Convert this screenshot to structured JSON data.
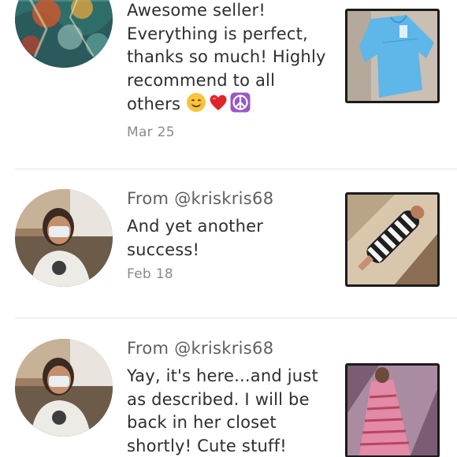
{
  "reviews": [
    {
      "author": "",
      "text": "Awesome seller!\nEverything is perfect,\nthanks so much! Highly\nrecommend to all\nothers",
      "emojis": [
        "smiling-face",
        "red-heart",
        "peace-symbol"
      ],
      "date": "Mar 25"
    },
    {
      "author": "From @kriskris68",
      "text": "And yet another\nsuccess!",
      "emojis": [],
      "date": "Feb 18"
    },
    {
      "author": "From @kriskris68",
      "text": "Yay, it's here...and just\nas described. I will be\nback in her closet\nshortly! Cute stuff!",
      "emojis": [],
      "date": ""
    }
  ]
}
